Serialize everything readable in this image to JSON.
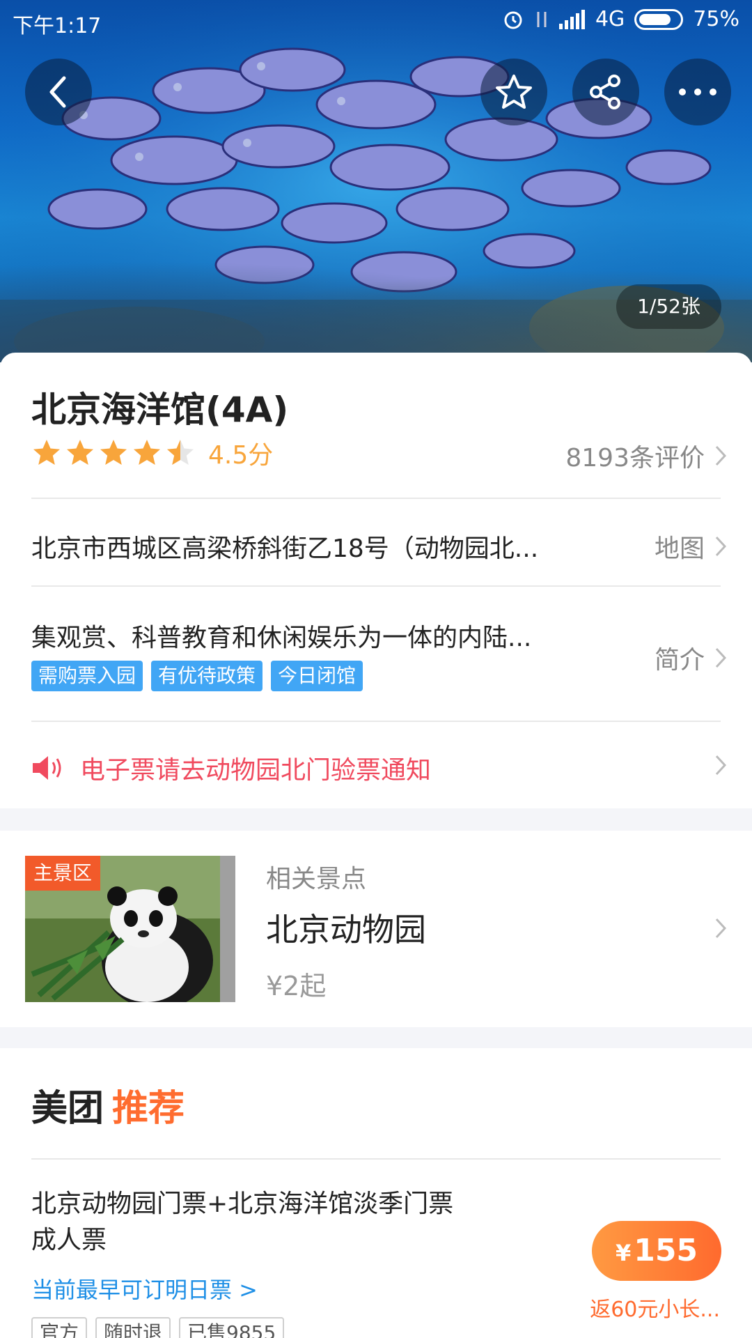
{
  "status_bar": {
    "time": "下午1:17",
    "network": "4G",
    "battery": "75%"
  },
  "hero": {
    "photo_count": "1/52张"
  },
  "attraction": {
    "title": "北京海洋馆(4A)",
    "rating_score": "4.5分",
    "rating_value": 4.5,
    "reviews": "8193条评价",
    "address": "北京市西城区高梁桥斜街乙18号（动物园北...",
    "map_link": "地图",
    "intro": "集观赏、科普教育和休闲娱乐为一体的内陆...",
    "intro_link": "简介",
    "tags": [
      "需购票入园",
      "有优待政策",
      "今日闭馆"
    ],
    "notice": "电子票请去动物园北门验票通知"
  },
  "related": {
    "badge": "主景区",
    "subtitle": "相关景点",
    "name": "北京动物园",
    "price": "¥2起"
  },
  "recommend": {
    "title_a": "美团",
    "title_b": "推荐",
    "deal_title_line1": "北京动物园门票+北京海洋馆淡季门票",
    "deal_title_line2": "成人票",
    "deal_link": "当前最早可订明日票 >",
    "chips": [
      "官方",
      "随时退",
      "已售9855"
    ],
    "price_symbol": "¥",
    "price": "155",
    "cashback": "返60元小长..."
  },
  "colors": {
    "accent": "#ff6c2f",
    "tag_blue": "#41a6f5",
    "notice_red": "#f04a5e",
    "star": "#f8a53b"
  }
}
